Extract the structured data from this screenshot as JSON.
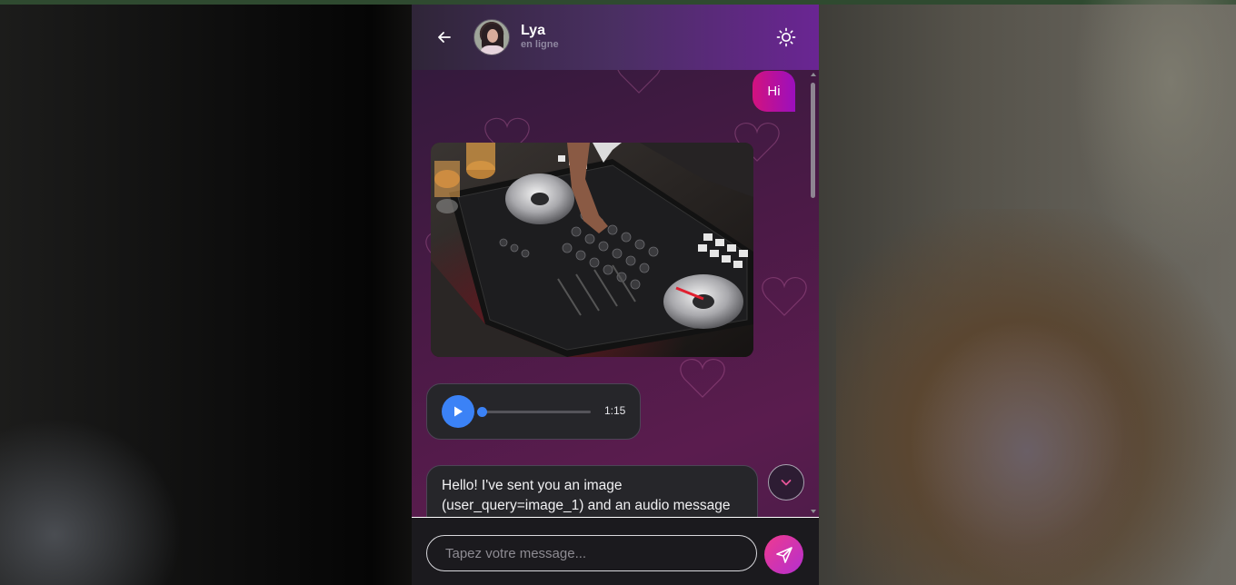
{
  "header": {
    "contact_name": "Lya",
    "contact_status": "en ligne",
    "back_icon": "arrow-left-icon",
    "theme_icon": "sun-icon"
  },
  "messages": [
    {
      "type": "text",
      "direction": "sent",
      "text": "Hi"
    },
    {
      "type": "image",
      "direction": "received",
      "subject": "DJ controller photo"
    },
    {
      "type": "audio",
      "direction": "received",
      "duration": "1:15",
      "progress": 0
    },
    {
      "type": "text",
      "direction": "received",
      "text": "Hello! I've sent you an image (user_query=image_1) and an audio message"
    }
  ],
  "composer": {
    "placeholder": "Tapez votre message...",
    "send_icon": "send-icon"
  },
  "scroll_down_icon": "chevron-down-icon",
  "colors": {
    "accent_pink": "#d3127e",
    "accent_purple": "#9b0fbe",
    "audio_blue": "#3b82f6"
  }
}
